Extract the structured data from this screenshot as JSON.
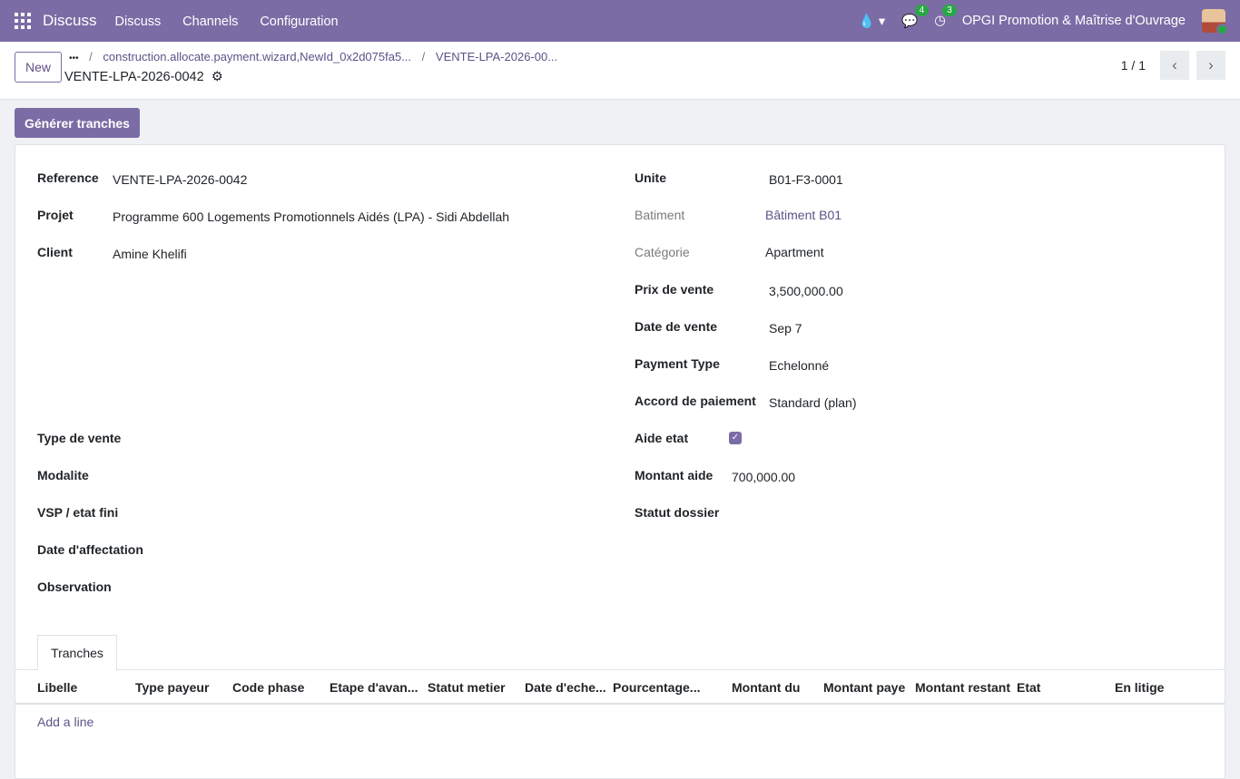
{
  "nav": {
    "app": "Discuss",
    "menu": [
      "Discuss",
      "Channels",
      "Configuration"
    ],
    "chat_count": "4",
    "activity_count": "3",
    "company": "OPGI Promotion & Maîtrise d'Ouvrage"
  },
  "control": {
    "new_label": "New",
    "dots": "•••",
    "breadcrumb_1": "construction.allocate.payment.wizard,NewId_0x2d075fa5...",
    "breadcrumb_2": "VENTE-LPA-2026-00...",
    "record_title": "VENTE-LPA-2026-0042",
    "pager": "1 / 1"
  },
  "actions": {
    "generate_label": "Générer tranches"
  },
  "left": [
    {
      "label": "Reference",
      "value": "VENTE-LPA-2026-0042"
    },
    {
      "label": "Projet",
      "value": "Programme 600 Logements Promotionnels Aidés (LPA) - Sidi Abdellah"
    },
    {
      "label": "Client",
      "value": "Amine Khelifi"
    },
    {
      "label": "Type de vente",
      "value": ""
    },
    {
      "label": "Modalite",
      "value": ""
    },
    {
      "label": "VSP / etat fini",
      "value": ""
    },
    {
      "label": "Date d'affectation",
      "value": ""
    },
    {
      "label": "Observation",
      "value": ""
    }
  ],
  "right": [
    {
      "label": "Unite",
      "value": "B01-F3-0001"
    },
    {
      "label": "Batiment",
      "value": "Bâtiment B01"
    },
    {
      "label": "Catégorie",
      "value": "Apartment"
    },
    {
      "label": "Prix de vente",
      "value": "3,500,000.00"
    },
    {
      "label": "Date de vente",
      "value": "Sep 7"
    },
    {
      "label": "Payment Type",
      "value": "Echelonné"
    },
    {
      "label": "Accord de paiement",
      "value": "Standard (plan)"
    },
    {
      "label": "Aide etat",
      "value": ""
    },
    {
      "label": "Montant aide",
      "value": "700,000.00"
    },
    {
      "label": "Statut dossier",
      "value": ""
    }
  ],
  "tab": "Tranches",
  "columns": [
    "Libelle",
    "Type payeur",
    "Code phase",
    "Etape d'avan...",
    "Statut metier",
    "Date d'eche...",
    "Pourcentage...",
    "Montant du",
    "Montant paye",
    "Montant restant",
    "Etat",
    "En litige"
  ],
  "add_line": "Add a line"
}
